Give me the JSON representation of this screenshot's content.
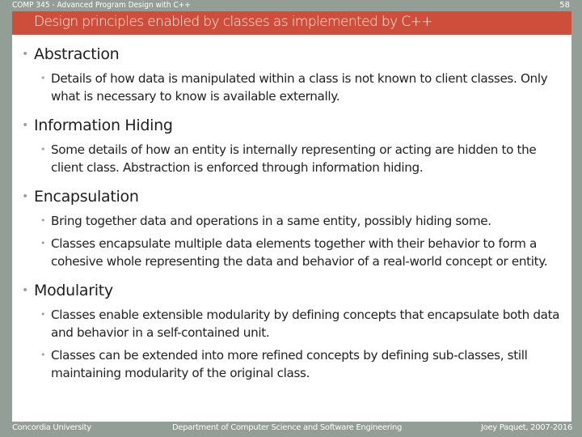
{
  "header": {
    "course": "COMP 345 - Advanced Program Design with C++",
    "page_number": "58"
  },
  "slide": {
    "title": "Design principles enabled by classes as implemented by C++",
    "bullet_glyph": "•",
    "sections": [
      {
        "heading": "Abstraction",
        "items": [
          "Details of how data is manipulated within a class is not known to client classes. Only what is necessary to know is available externally."
        ]
      },
      {
        "heading": "Information Hiding",
        "items": [
          "Some details of how an entity is internally representing or acting are hidden to the client class. Abstraction is enforced through information hiding."
        ]
      },
      {
        "heading": "Encapsulation",
        "items": [
          "Bring together data and operations in a same entity, possibly hiding some.",
          "Classes encapsulate multiple data elements together with their behavior to form a cohesive whole representing the data and behavior of a real-world concept or entity."
        ]
      },
      {
        "heading": "Modularity",
        "items": [
          "Classes enable extensible modularity by defining concepts that encapsulate both data and behavior in a self-contained unit.",
          "Classes can be extended into more refined concepts by defining sub-classes, still maintaining modularity of the original class."
        ]
      }
    ]
  },
  "footer": {
    "left": "Concordia University",
    "center": "Department of Computer Science and Software Engineering",
    "right": "Joey Paquet, 2007-2016"
  },
  "colors": {
    "frame": "#929e96",
    "title_bar": "#cd4f3b",
    "slide_bg": "#ffffff"
  }
}
